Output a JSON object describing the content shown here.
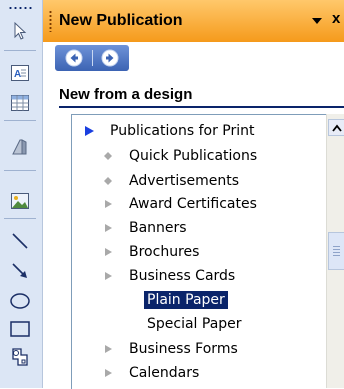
{
  "toolbar": {
    "tools": [
      "select-arrow-icon",
      "text-box-icon",
      "table-icon",
      "wordart-icon",
      "picture-icon",
      "line-icon",
      "arrow-icon",
      "oval-icon",
      "rectangle-icon",
      "autoshapes-icon"
    ]
  },
  "pane": {
    "title": "New Publication",
    "close_glyph": "x"
  },
  "section": {
    "title": "New from a design"
  },
  "tree": {
    "items": [
      {
        "label": "Publications for Print",
        "marker": "expanded-arrow",
        "level": 0,
        "selected": false
      },
      {
        "label": "Quick Publications",
        "marker": "diamond",
        "level": 1,
        "selected": false
      },
      {
        "label": "Advertisements",
        "marker": "diamond",
        "level": 1,
        "selected": false
      },
      {
        "label": "Award Certificates",
        "marker": "collapsed-arrow",
        "level": 1,
        "selected": false
      },
      {
        "label": "Banners",
        "marker": "collapsed-arrow",
        "level": 1,
        "selected": false
      },
      {
        "label": "Brochures",
        "marker": "collapsed-arrow",
        "level": 1,
        "selected": false
      },
      {
        "label": "Business Cards",
        "marker": "collapsed-arrow",
        "level": 1,
        "selected": false
      },
      {
        "label": "Plain Paper",
        "marker": "none",
        "level": 2,
        "selected": true
      },
      {
        "label": "Special Paper",
        "marker": "none",
        "level": 2,
        "selected": false
      },
      {
        "label": "Business Forms",
        "marker": "collapsed-arrow",
        "level": 1,
        "selected": false
      },
      {
        "label": "Calendars",
        "marker": "collapsed-arrow",
        "level": 1,
        "selected": false
      }
    ]
  },
  "colors": {
    "header_start": "#ffc86b",
    "header_end": "#f59a1b",
    "selection": "#0a246a",
    "expanded_arrow": "#1a3fe0",
    "collapsed_arrow": "#a9a9a9",
    "nav_button": "#3c63b3"
  }
}
